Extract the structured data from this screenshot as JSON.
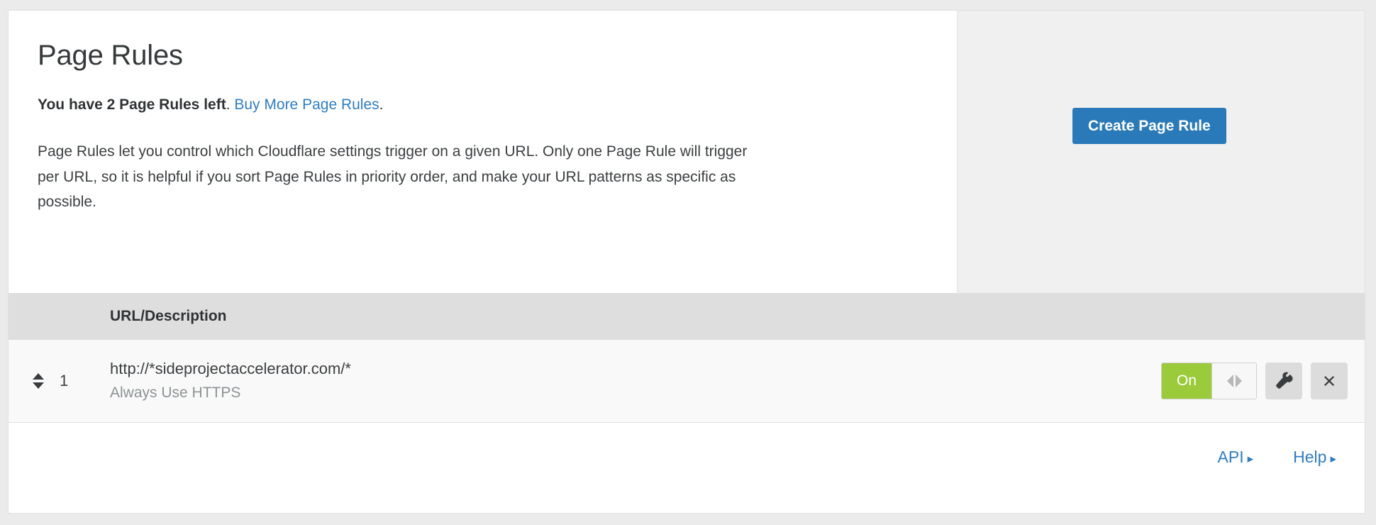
{
  "page": {
    "title": "Page Rules"
  },
  "quota": {
    "strong_text": "You have 2 Page Rules left",
    "separator": ". ",
    "buy_link": "Buy More Page Rules",
    "trailing": "."
  },
  "description": "Page Rules let you control which Cloudflare settings trigger on a given URL. Only one Page Rule will trigger per URL, so it is helpful if you sort Page Rules in priority order, and make your URL patterns as specific as possible.",
  "actions": {
    "create_button": "Create Page Rule"
  },
  "table": {
    "columns": {
      "url_description": "URL/Description"
    },
    "rows": [
      {
        "index": "1",
        "url": "http://*sideprojectaccelerator.com/*",
        "setting": "Always Use HTTPS",
        "toggle_state": "On"
      }
    ]
  },
  "footer": {
    "api_label": "API",
    "help_label": "Help",
    "caret": "▸"
  },
  "colors": {
    "accent_blue": "#2a7ab9",
    "link_blue": "#2f7dc0",
    "toggle_green": "#9bca3a",
    "header_gray": "#dedede",
    "panel_gray": "#f0f0f0",
    "page_bg": "#ebebeb"
  }
}
